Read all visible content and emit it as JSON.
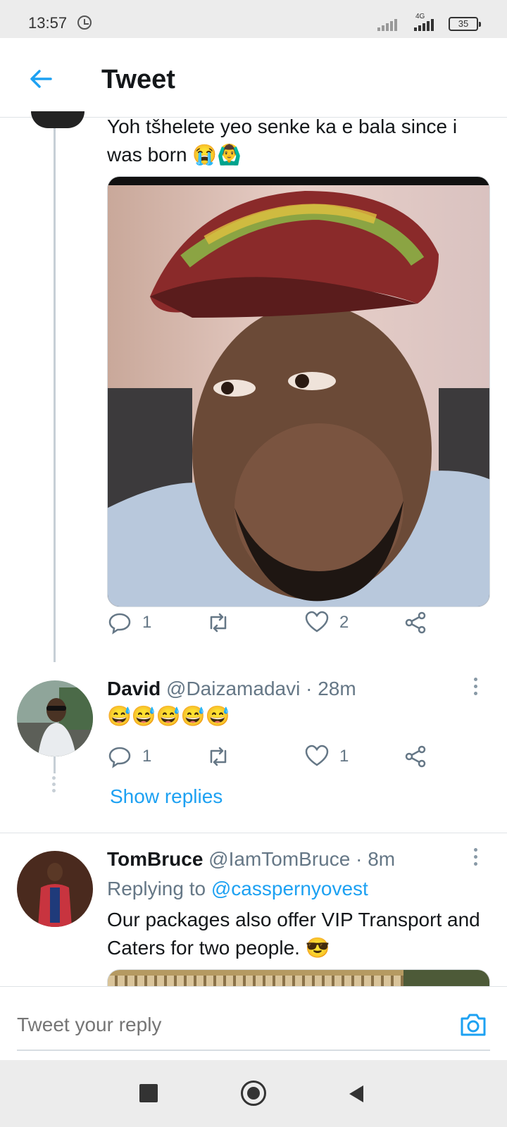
{
  "status_bar": {
    "time": "13:57",
    "network": "4G",
    "battery": "35"
  },
  "header": {
    "title": "Tweet",
    "back_icon": "arrow-left-icon"
  },
  "main_tweet": {
    "text": "Yoh tšhelete yeo senke ka e bala since i was born 😭🙆‍♂️",
    "actions": {
      "reply_count": "1",
      "retweet_count": "",
      "like_count": "2"
    }
  },
  "replies": [
    {
      "name": "David",
      "handle": "@Daizamadavi",
      "time": "· 28m",
      "text": "😅😅😅😅😅",
      "actions": {
        "reply_count": "1",
        "like_count": "1"
      },
      "show_replies": "Show replies"
    },
    {
      "name": "TomBruce",
      "handle": "@IamTomBruce",
      "time": "· 8m",
      "replying_label": "Replying to",
      "replying_handle": "@casspernyovest",
      "text": "Our packages also offer VIP Transport and Caters for two people. 😎"
    }
  ],
  "reply_box": {
    "placeholder": "Tweet your reply"
  },
  "colors": {
    "accent": "#1da1f2",
    "text": "#14171a",
    "secondary": "#657786"
  }
}
